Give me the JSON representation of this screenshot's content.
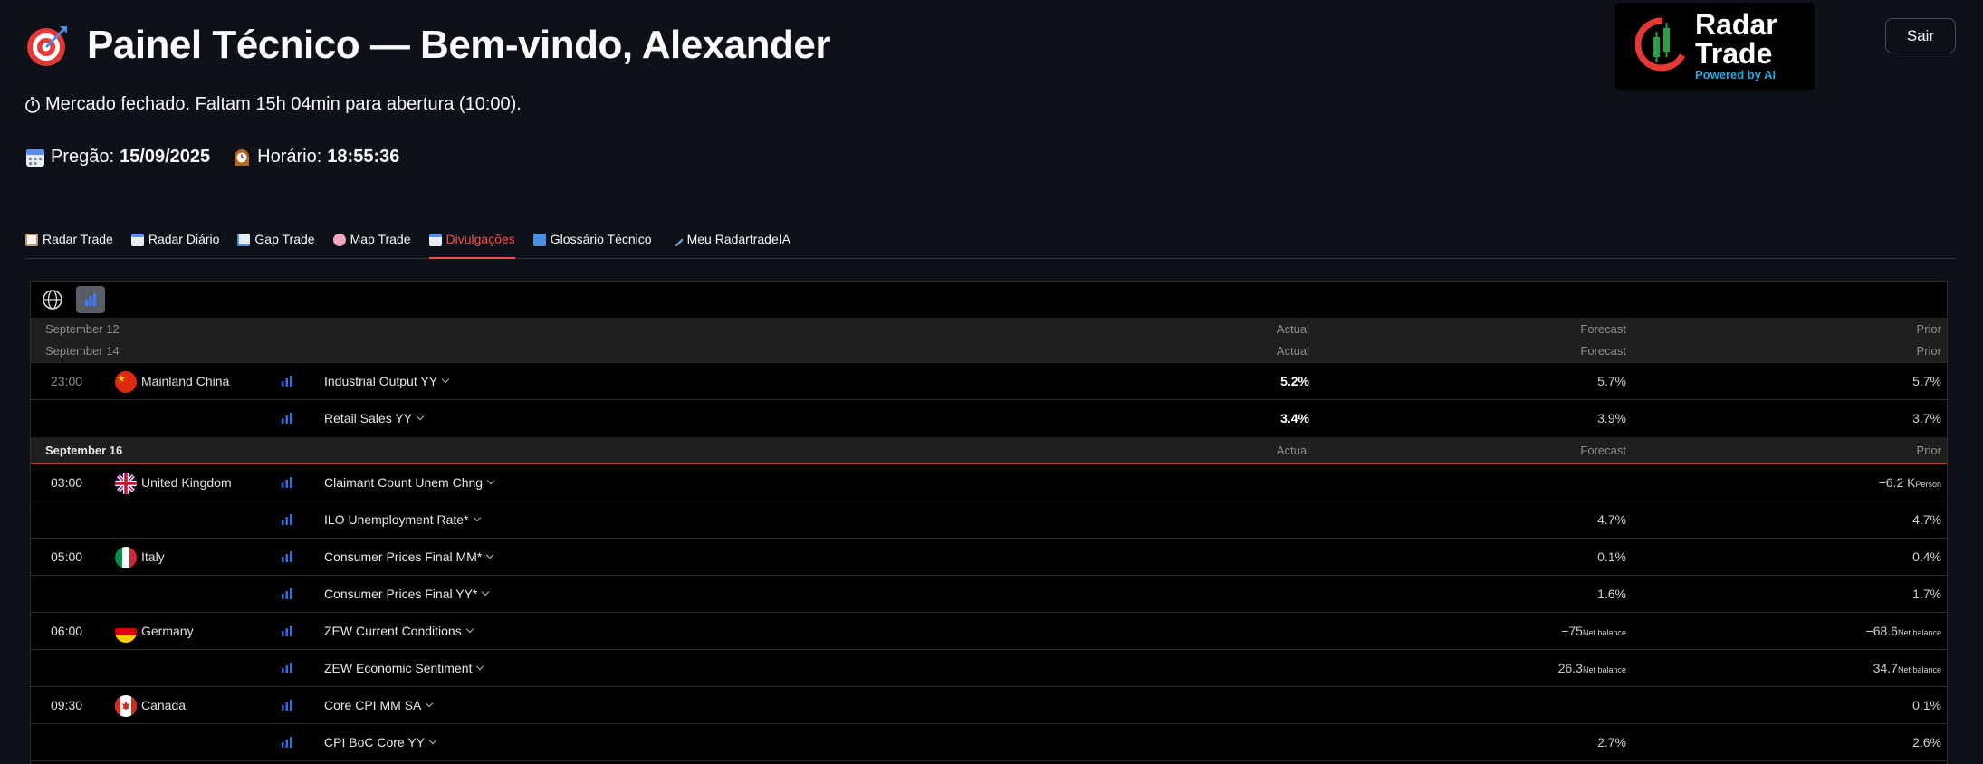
{
  "header": {
    "title": "Painel Técnico — Bem-vindo, Alexander",
    "logout_label": "Sair",
    "logo": {
      "line1": "Radar",
      "line2": "Trade",
      "tagline": "Powered by AI"
    }
  },
  "status": {
    "market_text": "Mercado fechado. Faltam 15h 04min para abertura (10:00).",
    "session_label": "Pregão:",
    "session_date": "15/09/2025",
    "time_label": "Horário:",
    "time_value": "18:55:36"
  },
  "tabs": [
    {
      "label": "Radar Trade",
      "icon": "clipboard-icon",
      "active": false
    },
    {
      "label": "Radar Diário",
      "icon": "calendar-icon",
      "active": false
    },
    {
      "label": "Gap Trade",
      "icon": "chart-icon",
      "active": false
    },
    {
      "label": "Map Trade",
      "icon": "brain-icon",
      "active": false
    },
    {
      "label": "Divulgações",
      "icon": "calendar-icon",
      "active": true
    },
    {
      "label": "Glossário Técnico",
      "icon": "book-icon",
      "active": false
    },
    {
      "label": "Meu RadartradeIA",
      "icon": "pen-icon",
      "active": false
    }
  ],
  "calendar": {
    "columns": {
      "actual": "Actual",
      "forecast": "Forecast",
      "prior": "Prior"
    },
    "headers": [
      {
        "date": "September 12"
      },
      {
        "date": "September 14"
      },
      {
        "date": "September 16"
      }
    ],
    "events": [
      {
        "time": "23:00",
        "country": "Mainland China",
        "name": "Industrial Output YY",
        "actual": "5.2%",
        "forecast": "5.7%",
        "prior": "5.7%"
      },
      {
        "time": "",
        "country": "",
        "name": "Retail Sales YY",
        "actual": "3.4%",
        "forecast": "3.9%",
        "prior": "3.7%"
      },
      {
        "time": "03:00",
        "country": "United Kingdom",
        "name": "Claimant Count Unem Chng",
        "actual": "",
        "forecast": "",
        "prior": "−6.2 K",
        "prior_unit": "Person"
      },
      {
        "time": "",
        "country": "",
        "name": "ILO Unemployment Rate*",
        "actual": "",
        "forecast": "4.7%",
        "prior": "4.7%"
      },
      {
        "time": "05:00",
        "country": "Italy",
        "name": "Consumer Prices Final MM*",
        "actual": "",
        "forecast": "0.1%",
        "prior": "0.4%"
      },
      {
        "time": "",
        "country": "",
        "name": "Consumer Prices Final YY*",
        "actual": "",
        "forecast": "1.6%",
        "prior": "1.7%"
      },
      {
        "time": "06:00",
        "country": "Germany",
        "name": "ZEW Current Conditions",
        "actual": "",
        "forecast": "−75",
        "forecast_unit": "Net balance",
        "prior": "−68.6",
        "prior_unit": "Net balance"
      },
      {
        "time": "",
        "country": "",
        "name": "ZEW Economic Sentiment",
        "actual": "",
        "forecast": "26.3",
        "forecast_unit": "Net balance",
        "prior": "34.7",
        "prior_unit": "Net balance"
      },
      {
        "time": "09:30",
        "country": "Canada",
        "name": "Core CPI MM SA",
        "actual": "",
        "forecast": "",
        "prior": "0.1%"
      },
      {
        "time": "",
        "country": "",
        "name": "CPI BoC Core YY",
        "actual": "",
        "forecast": "2.7%",
        "prior": "2.6%"
      }
    ]
  },
  "colors": {
    "accent": "#ff4b4b",
    "background": "#0e1117",
    "panel": "#000000",
    "bars": "#2f6fe0"
  }
}
